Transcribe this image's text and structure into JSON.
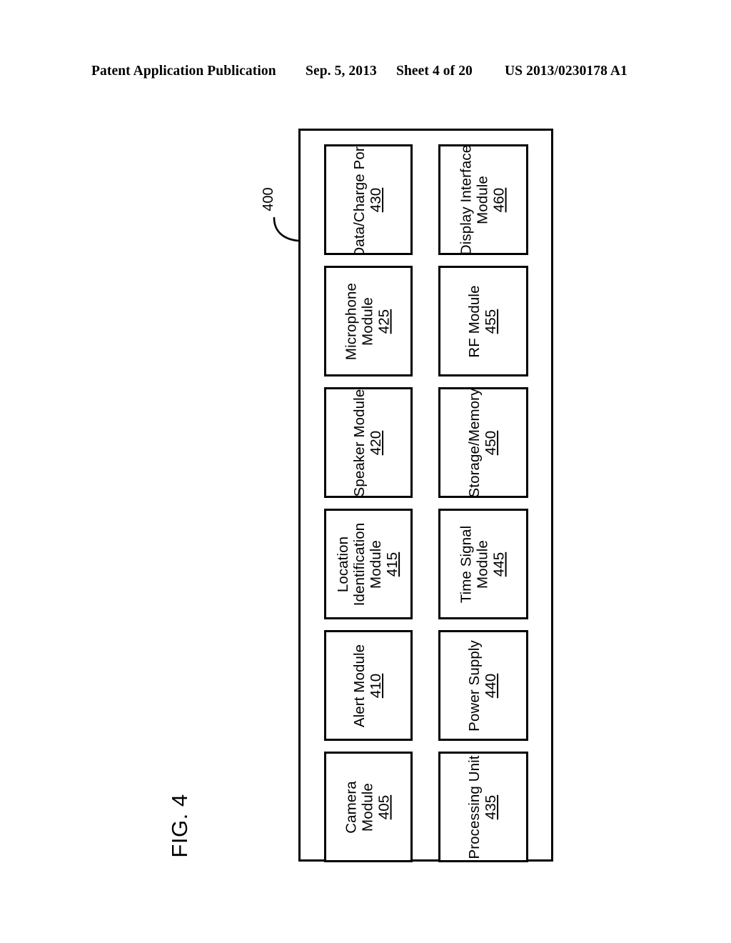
{
  "header": {
    "publication": "Patent Application Publication",
    "date": "Sep. 5, 2013",
    "sheet": "Sheet 4 of 20",
    "patent_number": "US 2013/0230178 A1"
  },
  "figure": {
    "label": "FIG. 4",
    "system_reference": "400"
  },
  "diagram": {
    "left_column": [
      {
        "lines": [
          "Data/Charge Port"
        ],
        "number": "430"
      },
      {
        "lines": [
          "Microphone",
          "Module"
        ],
        "number": "425"
      },
      {
        "lines": [
          "Speaker Module"
        ],
        "number": "420"
      },
      {
        "lines": [
          "Location",
          "Identification",
          "Module"
        ],
        "number": "415"
      },
      {
        "lines": [
          "Alert Module"
        ],
        "number": "410"
      },
      {
        "lines": [
          "Camera",
          "Module"
        ],
        "number": "405"
      }
    ],
    "right_column": [
      {
        "lines": [
          "Display Interface",
          "Module"
        ],
        "number": "460"
      },
      {
        "lines": [
          "RF Module"
        ],
        "number": "455"
      },
      {
        "lines": [
          "Storage/Memory"
        ],
        "number": "450"
      },
      {
        "lines": [
          "Time Signal",
          "Module"
        ],
        "number": "445"
      },
      {
        "lines": [
          "Power Supply"
        ],
        "number": "440"
      },
      {
        "lines": [
          "Processing Unit"
        ],
        "number": "435"
      }
    ]
  },
  "colors": {
    "ink": "#000000",
    "paper": "#ffffff"
  }
}
